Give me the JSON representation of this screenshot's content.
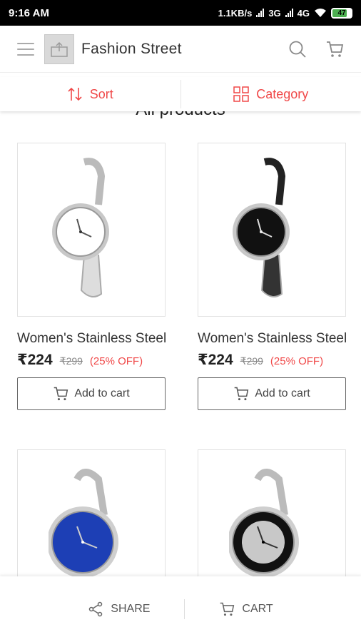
{
  "status_bar": {
    "time": "9:16 AM",
    "net_speed": "1.1KB/s",
    "net1": "3G",
    "net2": "4G",
    "battery": "47"
  },
  "header": {
    "title": "Fashion Street",
    "icons": [
      "menu-icon",
      "store-logo",
      "search-icon",
      "cart-icon"
    ]
  },
  "filters": {
    "sort_label": "Sort",
    "category_label": "Category",
    "accent_color": "#f04848"
  },
  "section_title": "All products",
  "products": [
    {
      "name": "Women's Stainless Steel",
      "price": "₹224",
      "mrp": "₹299",
      "discount": "(25% OFF)",
      "button": "Add to cart",
      "dial": "white"
    },
    {
      "name": "Women's Stainless Steel",
      "price": "₹224",
      "mrp": "₹299",
      "discount": "(25% OFF)",
      "button": "Add to cart",
      "dial": "black"
    },
    {
      "name": "",
      "price": "",
      "mrp": "",
      "discount": "",
      "button": "",
      "dial": "blue"
    },
    {
      "name": "",
      "price": "",
      "mrp": "",
      "discount": "",
      "button": "",
      "dial": "black-silver"
    }
  ],
  "bottom_bar": {
    "share_label": "SHARE",
    "cart_label": "CART"
  }
}
